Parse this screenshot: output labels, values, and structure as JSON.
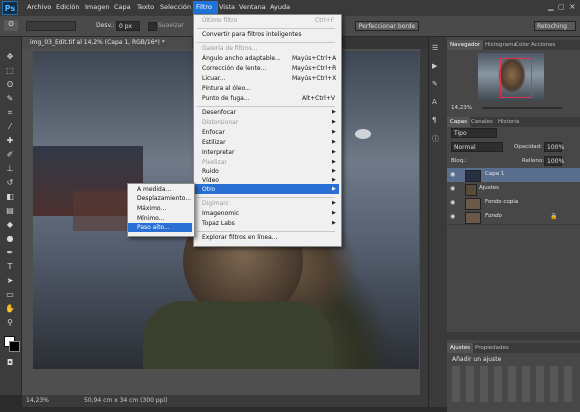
{
  "menubar": {
    "logo": "Ps",
    "items": [
      "Archivo",
      "Edición",
      "Imagen",
      "Capa",
      "Texto",
      "Selección",
      "Filtro",
      "Vista",
      "Ventana",
      "Ayuda"
    ]
  },
  "options": {
    "desv_label": "Desv.:",
    "desv_value": "0 px",
    "suavizar": "Suavizar",
    "refine_button": "Perfeccionar borde",
    "workspace": "Retoching"
  },
  "document": {
    "tab_title": "img_03_Edit.tif al 14,2% (Capa 1, RGB/16*) *",
    "zoom": "14,23%",
    "doc_info": "50,94 cm x 34 cm (300 ppi)"
  },
  "filtro_menu": {
    "items": [
      {
        "label": "Último filtro",
        "shortcut": "Ctrl+F",
        "disabled": true
      },
      {
        "label": "Convertir para filtros inteligentes",
        "shortcut": "",
        "disabled": false
      },
      {
        "label": "Galería de filtros...",
        "shortcut": "",
        "disabled": true
      },
      {
        "label": "Ángulo ancho adaptable...",
        "shortcut": "Mayús+Ctrl+A",
        "disabled": false
      },
      {
        "label": "Corrección de lente...",
        "shortcut": "Mayús+Ctrl+R",
        "disabled": false
      },
      {
        "label": "Licuar...",
        "shortcut": "Mayús+Ctrl+X",
        "disabled": false
      },
      {
        "label": "Pintura al óleo...",
        "shortcut": "",
        "disabled": false
      },
      {
        "label": "Punto de fuga...",
        "shortcut": "Alt+Ctrl+V",
        "disabled": false
      },
      {
        "label": "Desenfocar",
        "shortcut": "",
        "disabled": false
      },
      {
        "label": "Distorsionar",
        "shortcut": "",
        "disabled": true
      },
      {
        "label": "Enfocar",
        "shortcut": "",
        "disabled": false
      },
      {
        "label": "Estilizar",
        "shortcut": "",
        "disabled": false
      },
      {
        "label": "Interpretar",
        "shortcut": "",
        "disabled": false
      },
      {
        "label": "Pixelizar",
        "shortcut": "",
        "disabled": true
      },
      {
        "label": "Ruido",
        "shortcut": "",
        "disabled": false
      },
      {
        "label": "Vídeo",
        "shortcut": "",
        "disabled": false
      },
      {
        "label": "Otro",
        "shortcut": "",
        "disabled": false
      },
      {
        "label": "Digimarc",
        "shortcut": "",
        "disabled": true
      },
      {
        "label": "Imagenomic",
        "shortcut": "",
        "disabled": false
      },
      {
        "label": "Topaz Labs",
        "shortcut": "",
        "disabled": false
      },
      {
        "label": "Explorar filtros en línea...",
        "shortcut": "",
        "disabled": false
      }
    ]
  },
  "otro_submenu": {
    "items": [
      "A medida...",
      "Desplazamiento...",
      "Máximo...",
      "Mínimo...",
      "Paso alto..."
    ]
  },
  "panels": {
    "navigator_tabs": [
      "Navegador",
      "Histograma",
      "Color",
      "Acciones"
    ],
    "nav_zoom": "14,23%",
    "layers_tabs": [
      "Capas",
      "Canales",
      "Historia"
    ],
    "kind_label": "Tipo",
    "blend_mode": "Normal",
    "opacity_label": "Opacidad:",
    "opacity_value": "100%",
    "lock_label": "Bloq.:",
    "fill_label": "Relleno:",
    "fill_value": "100%",
    "layers": [
      {
        "name": "Capa 1",
        "selected": true
      },
      {
        "name": "Ajustes",
        "selected": false
      },
      {
        "name": "Fondo copia",
        "selected": false
      },
      {
        "name": "Fondo",
        "selected": false
      }
    ],
    "adjust_tabs": [
      "Ajustes",
      "Propiedades"
    ],
    "adjust_title": "Añadir un ajuste"
  }
}
